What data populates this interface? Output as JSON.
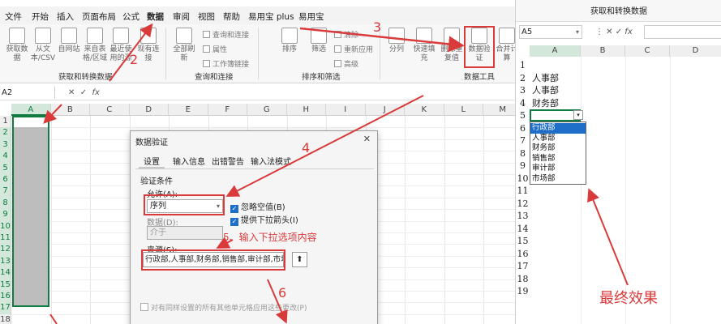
{
  "menu": {
    "items": [
      "文件",
      "开始",
      "插入",
      "页面布局",
      "公式",
      "数据",
      "审阅",
      "视图",
      "帮助",
      "易用宝 plus",
      "易用宝"
    ],
    "active": "数据"
  },
  "ribbon": {
    "get_transform": {
      "buttons": [
        "获取数据",
        "从文本/CSV",
        "自网站",
        "来自表格/区域",
        "最近使用的源",
        "现有连接"
      ],
      "group_label": "获取和转换数据"
    },
    "queries": {
      "refresh": "全部刷新",
      "small": [
        "查询和连接",
        "属性",
        "工作簿链接"
      ],
      "group_label": "查询和连接"
    },
    "sort_filter": {
      "items": [
        "排序",
        "筛选"
      ],
      "small": [
        "清除",
        "重新应用",
        "高级"
      ],
      "group_label": "排序和筛选"
    },
    "data_tools": {
      "items": [
        "分列",
        "快速填充",
        "删除重复值",
        "数据验证",
        "合并计算"
      ],
      "group_label": "数据工具"
    }
  },
  "left_formula": {
    "namebox": "A2",
    "fx": "fx"
  },
  "left_columns": [
    "A",
    "B",
    "C",
    "D",
    "E",
    "F",
    "G",
    "H",
    "I",
    "J",
    "K",
    "L",
    "M"
  ],
  "left_rows": [
    "1",
    "2",
    "3",
    "4",
    "5",
    "6",
    "7",
    "8",
    "9",
    "10",
    "11",
    "12",
    "13",
    "14",
    "15",
    "16",
    "17",
    "18"
  ],
  "dialog": {
    "title": "数据验证",
    "close": "✕",
    "tabs": [
      "设置",
      "输入信息",
      "出错警告",
      "输入法模式"
    ],
    "criteria_label": "验证条件",
    "allow_label": "允许(A):",
    "allow_value": "序列",
    "data_label": "数据(D):",
    "data_value": "介于",
    "ignore_blank": "忽略空值(B)",
    "dropdown_arrow": "提供下拉箭头(I)",
    "source_label": "来源(S):",
    "source_value": "行政部,人事部,财务部,销售部,审计部,市场部",
    "apply_all": "对有同样设置的所有其他单元格应用这些更改(P)"
  },
  "right_window": {
    "group_label": "获取和转换数据",
    "namebox": "A5",
    "fx": "fx",
    "columns": [
      "A",
      "B",
      "C",
      "D"
    ],
    "rows": [
      "1",
      "2",
      "3",
      "4",
      "5",
      "6",
      "7",
      "8",
      "9",
      "10",
      "11",
      "12",
      "13",
      "14",
      "15",
      "16",
      "17",
      "18",
      "19"
    ],
    "cells": [
      "",
      "人事部",
      "人事部",
      "财务部"
    ],
    "dropdown_items": [
      "行政部",
      "人事部",
      "财务部",
      "销售部",
      "审计部",
      "市场部"
    ]
  },
  "annotations": {
    "n2": "2",
    "n3": "3",
    "n4": "4",
    "n5": "5、输入下拉选项内容",
    "n6": "6",
    "final": "最终效果"
  },
  "colors": {
    "excel_green": "#107c41",
    "annotation_red": "#d93a3a",
    "highlight_blue": "#1f6fc9"
  }
}
